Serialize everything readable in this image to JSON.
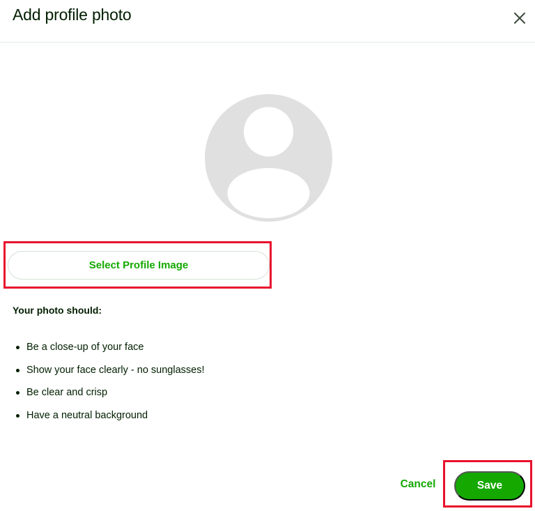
{
  "dialog": {
    "title": "Add profile photo",
    "close_icon": "close-icon"
  },
  "avatar": {
    "icon": "user-placeholder-icon",
    "color": "#e0e0e0"
  },
  "select_button": {
    "label": "Select Profile Image"
  },
  "guidelines": {
    "heading": "Your photo should:",
    "items": [
      "Be a close-up of your face",
      "Show your face clearly - no sunglasses!",
      "Be clear and crisp",
      "Have a neutral background"
    ]
  },
  "footer": {
    "cancel_label": "Cancel",
    "save_label": "Save"
  },
  "colors": {
    "brand_green": "#14a800",
    "highlight_red": "#e8112d",
    "text": "#001e00"
  }
}
